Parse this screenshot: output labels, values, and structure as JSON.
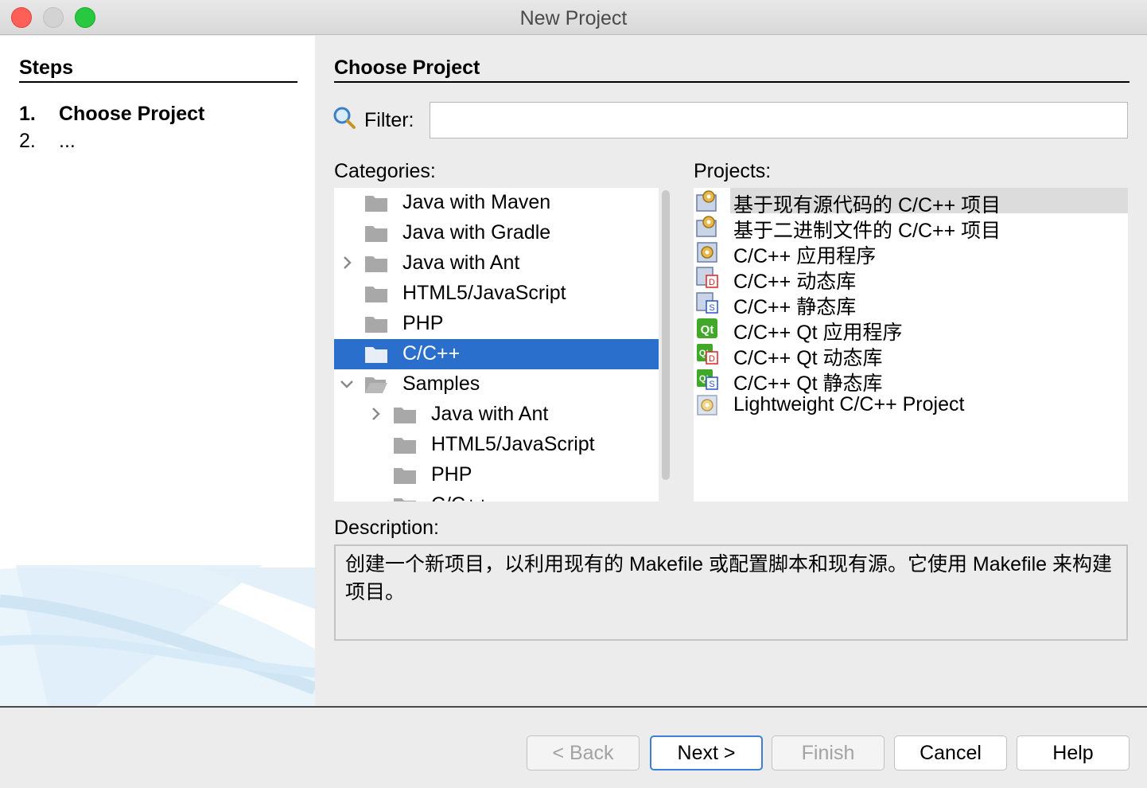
{
  "window": {
    "title": "New Project"
  },
  "steps": {
    "title": "Steps",
    "items": [
      {
        "num": "1.",
        "label": "Choose Project"
      },
      {
        "num": "2.",
        "label": "..."
      }
    ]
  },
  "main": {
    "section_title": "Choose Project",
    "filter": {
      "label": "Filter:",
      "value": ""
    },
    "categories_label": "Categories:",
    "projects_label": "Projects:",
    "categories": [
      {
        "label": "Java with Maven",
        "level": 0,
        "expander": ""
      },
      {
        "label": "Java with Gradle",
        "level": 0,
        "expander": ""
      },
      {
        "label": "Java with Ant",
        "level": 0,
        "expander": "collapsed"
      },
      {
        "label": "HTML5/JavaScript",
        "level": 0,
        "expander": ""
      },
      {
        "label": "PHP",
        "level": 0,
        "expander": ""
      },
      {
        "label": "C/C++",
        "level": 0,
        "expander": "",
        "selected": true
      },
      {
        "label": "Samples",
        "level": 0,
        "expander": "expanded",
        "open": true
      },
      {
        "label": "Java with Ant",
        "level": 1,
        "expander": "collapsed"
      },
      {
        "label": "HTML5/JavaScript",
        "level": 1,
        "expander": ""
      },
      {
        "label": "PHP",
        "level": 1,
        "expander": ""
      },
      {
        "label": "C/C++",
        "level": 1,
        "expander": ""
      }
    ],
    "projects": [
      {
        "label": "基于现有源代码的 C/C++ 项目",
        "icon": "gear-folder-icon",
        "selected": true
      },
      {
        "label": "基于二进制文件的 C/C++ 项目",
        "icon": "gear-folder-icon"
      },
      {
        "label": "C/C++ 应用程序",
        "icon": "gear-app-icon"
      },
      {
        "label": "C/C++ 动态库",
        "icon": "dynamic-library-icon"
      },
      {
        "label": "C/C++ 静态库",
        "icon": "static-library-icon"
      },
      {
        "label": "C/C++ Qt 应用程序",
        "icon": "qt-app-icon"
      },
      {
        "label": "C/C++ Qt 动态库",
        "icon": "qt-dynamic-library-icon"
      },
      {
        "label": "C/C++ Qt 静态库",
        "icon": "qt-static-library-icon"
      },
      {
        "label": "Lightweight C/C++ Project",
        "icon": "gear-light-icon"
      }
    ],
    "description_label": "Description:",
    "description": "创建一个新项目，以利用现有的 Makefile 或配置脚本和现有源。它使用 Makefile 来构建项目。"
  },
  "buttons": {
    "back": "< Back",
    "next": "Next >",
    "finish": "Finish",
    "cancel": "Cancel",
    "help": "Help"
  },
  "colors": {
    "selection": "#2b6fcc",
    "project_highlight": "#dcdcdc",
    "close": "#fe5f57",
    "maximize": "#28c840"
  }
}
